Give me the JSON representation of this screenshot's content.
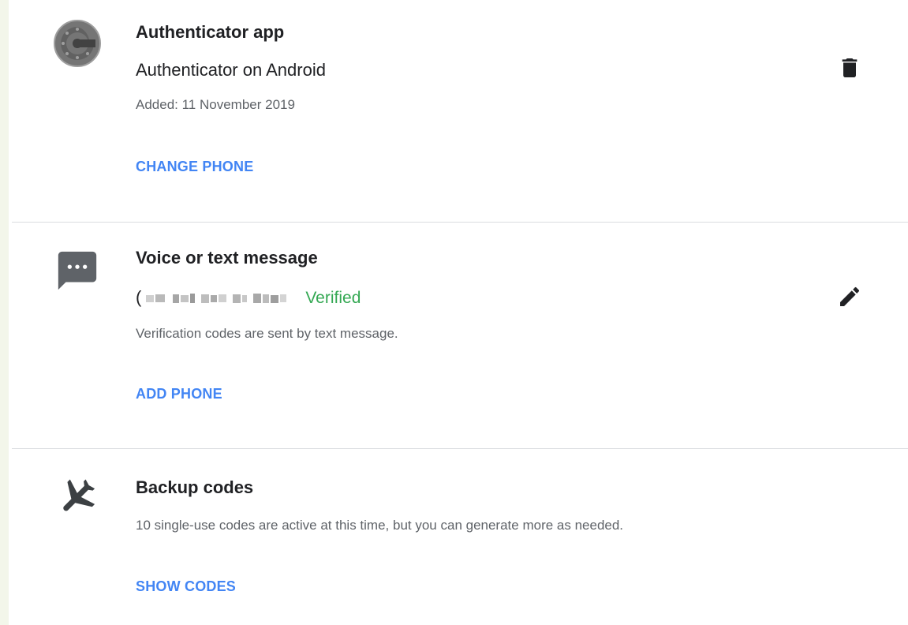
{
  "authenticator": {
    "title": "Authenticator app",
    "device": "Authenticator on Android",
    "added": "Added: 11 November 2019",
    "change_phone_label": "CHANGE PHONE",
    "icon": "google-authenticator-icon",
    "action_icon": "trash-icon"
  },
  "voice_text": {
    "title": "Voice or text message",
    "phone_prefix": "(",
    "verified_label": "Verified",
    "description": "Verification codes are sent by text message.",
    "add_phone_label": "ADD PHONE",
    "icon": "message-icon",
    "action_icon": "pencil-icon"
  },
  "backup_codes": {
    "title": "Backup codes",
    "description": "10 single-use codes are active at this time, but you can generate more as needed.",
    "show_codes_label": "SHOW CODES",
    "icon": "airplane-icon"
  },
  "colors": {
    "link": "#4285f4",
    "verified": "#34a853",
    "text": "#202124",
    "secondary": "#5f6368"
  }
}
